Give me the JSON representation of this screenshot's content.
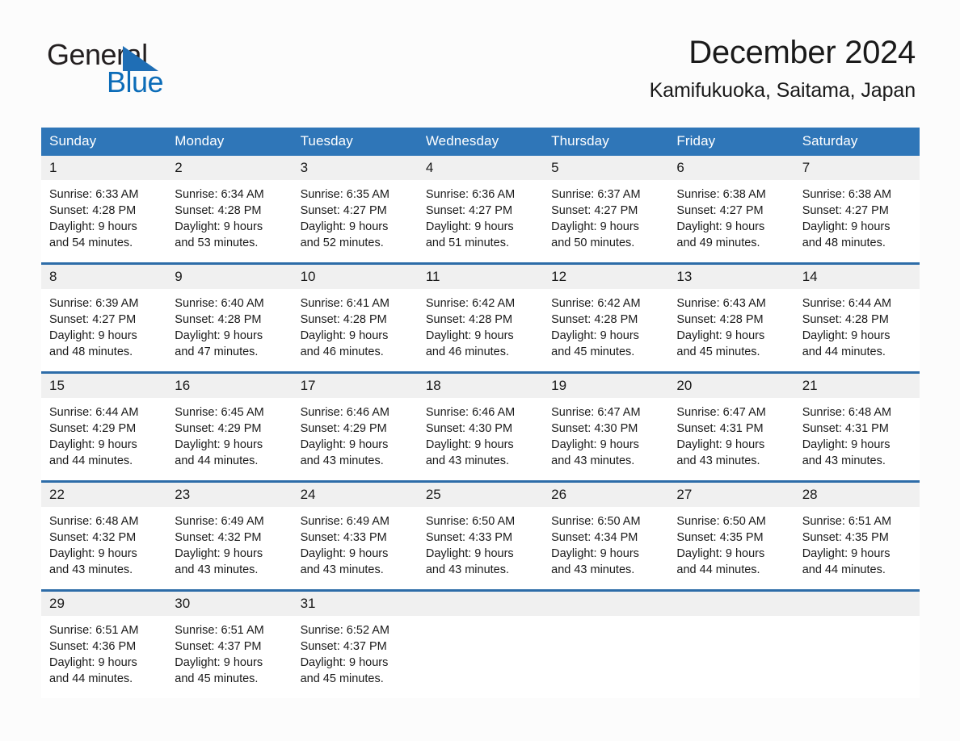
{
  "brand": {
    "name_part1": "General",
    "name_part2": "Blue",
    "triangle_icon": "triangle-icon",
    "accent_color": "#0b6cb8"
  },
  "header": {
    "title": "December 2024",
    "subtitle": "Kamifukuoka, Saitama, Japan"
  },
  "colors": {
    "header_blue": "#2f76b8",
    "divider_blue": "#2d6ca8",
    "daynum_bg": "#f0f0f0",
    "page_bg": "#fcfcfc"
  },
  "weekday_headers": [
    "Sunday",
    "Monday",
    "Tuesday",
    "Wednesday",
    "Thursday",
    "Friday",
    "Saturday"
  ],
  "labels": {
    "sunrise_prefix": "Sunrise:",
    "sunset_prefix": "Sunset:",
    "daylight_prefix": "Daylight:"
  },
  "weeks": [
    [
      {
        "day": "1",
        "sunrise": "Sunrise: 6:33 AM",
        "sunset": "Sunset: 4:28 PM",
        "daylight1": "Daylight: 9 hours",
        "daylight2": "and 54 minutes."
      },
      {
        "day": "2",
        "sunrise": "Sunrise: 6:34 AM",
        "sunset": "Sunset: 4:28 PM",
        "daylight1": "Daylight: 9 hours",
        "daylight2": "and 53 minutes."
      },
      {
        "day": "3",
        "sunrise": "Sunrise: 6:35 AM",
        "sunset": "Sunset: 4:27 PM",
        "daylight1": "Daylight: 9 hours",
        "daylight2": "and 52 minutes."
      },
      {
        "day": "4",
        "sunrise": "Sunrise: 6:36 AM",
        "sunset": "Sunset: 4:27 PM",
        "daylight1": "Daylight: 9 hours",
        "daylight2": "and 51 minutes."
      },
      {
        "day": "5",
        "sunrise": "Sunrise: 6:37 AM",
        "sunset": "Sunset: 4:27 PM",
        "daylight1": "Daylight: 9 hours",
        "daylight2": "and 50 minutes."
      },
      {
        "day": "6",
        "sunrise": "Sunrise: 6:38 AM",
        "sunset": "Sunset: 4:27 PM",
        "daylight1": "Daylight: 9 hours",
        "daylight2": "and 49 minutes."
      },
      {
        "day": "7",
        "sunrise": "Sunrise: 6:38 AM",
        "sunset": "Sunset: 4:27 PM",
        "daylight1": "Daylight: 9 hours",
        "daylight2": "and 48 minutes."
      }
    ],
    [
      {
        "day": "8",
        "sunrise": "Sunrise: 6:39 AM",
        "sunset": "Sunset: 4:27 PM",
        "daylight1": "Daylight: 9 hours",
        "daylight2": "and 48 minutes."
      },
      {
        "day": "9",
        "sunrise": "Sunrise: 6:40 AM",
        "sunset": "Sunset: 4:28 PM",
        "daylight1": "Daylight: 9 hours",
        "daylight2": "and 47 minutes."
      },
      {
        "day": "10",
        "sunrise": "Sunrise: 6:41 AM",
        "sunset": "Sunset: 4:28 PM",
        "daylight1": "Daylight: 9 hours",
        "daylight2": "and 46 minutes."
      },
      {
        "day": "11",
        "sunrise": "Sunrise: 6:42 AM",
        "sunset": "Sunset: 4:28 PM",
        "daylight1": "Daylight: 9 hours",
        "daylight2": "and 46 minutes."
      },
      {
        "day": "12",
        "sunrise": "Sunrise: 6:42 AM",
        "sunset": "Sunset: 4:28 PM",
        "daylight1": "Daylight: 9 hours",
        "daylight2": "and 45 minutes."
      },
      {
        "day": "13",
        "sunrise": "Sunrise: 6:43 AM",
        "sunset": "Sunset: 4:28 PM",
        "daylight1": "Daylight: 9 hours",
        "daylight2": "and 45 minutes."
      },
      {
        "day": "14",
        "sunrise": "Sunrise: 6:44 AM",
        "sunset": "Sunset: 4:28 PM",
        "daylight1": "Daylight: 9 hours",
        "daylight2": "and 44 minutes."
      }
    ],
    [
      {
        "day": "15",
        "sunrise": "Sunrise: 6:44 AM",
        "sunset": "Sunset: 4:29 PM",
        "daylight1": "Daylight: 9 hours",
        "daylight2": "and 44 minutes."
      },
      {
        "day": "16",
        "sunrise": "Sunrise: 6:45 AM",
        "sunset": "Sunset: 4:29 PM",
        "daylight1": "Daylight: 9 hours",
        "daylight2": "and 44 minutes."
      },
      {
        "day": "17",
        "sunrise": "Sunrise: 6:46 AM",
        "sunset": "Sunset: 4:29 PM",
        "daylight1": "Daylight: 9 hours",
        "daylight2": "and 43 minutes."
      },
      {
        "day": "18",
        "sunrise": "Sunrise: 6:46 AM",
        "sunset": "Sunset: 4:30 PM",
        "daylight1": "Daylight: 9 hours",
        "daylight2": "and 43 minutes."
      },
      {
        "day": "19",
        "sunrise": "Sunrise: 6:47 AM",
        "sunset": "Sunset: 4:30 PM",
        "daylight1": "Daylight: 9 hours",
        "daylight2": "and 43 minutes."
      },
      {
        "day": "20",
        "sunrise": "Sunrise: 6:47 AM",
        "sunset": "Sunset: 4:31 PM",
        "daylight1": "Daylight: 9 hours",
        "daylight2": "and 43 minutes."
      },
      {
        "day": "21",
        "sunrise": "Sunrise: 6:48 AM",
        "sunset": "Sunset: 4:31 PM",
        "daylight1": "Daylight: 9 hours",
        "daylight2": "and 43 minutes."
      }
    ],
    [
      {
        "day": "22",
        "sunrise": "Sunrise: 6:48 AM",
        "sunset": "Sunset: 4:32 PM",
        "daylight1": "Daylight: 9 hours",
        "daylight2": "and 43 minutes."
      },
      {
        "day": "23",
        "sunrise": "Sunrise: 6:49 AM",
        "sunset": "Sunset: 4:32 PM",
        "daylight1": "Daylight: 9 hours",
        "daylight2": "and 43 minutes."
      },
      {
        "day": "24",
        "sunrise": "Sunrise: 6:49 AM",
        "sunset": "Sunset: 4:33 PM",
        "daylight1": "Daylight: 9 hours",
        "daylight2": "and 43 minutes."
      },
      {
        "day": "25",
        "sunrise": "Sunrise: 6:50 AM",
        "sunset": "Sunset: 4:33 PM",
        "daylight1": "Daylight: 9 hours",
        "daylight2": "and 43 minutes."
      },
      {
        "day": "26",
        "sunrise": "Sunrise: 6:50 AM",
        "sunset": "Sunset: 4:34 PM",
        "daylight1": "Daylight: 9 hours",
        "daylight2": "and 43 minutes."
      },
      {
        "day": "27",
        "sunrise": "Sunrise: 6:50 AM",
        "sunset": "Sunset: 4:35 PM",
        "daylight1": "Daylight: 9 hours",
        "daylight2": "and 44 minutes."
      },
      {
        "day": "28",
        "sunrise": "Sunrise: 6:51 AM",
        "sunset": "Sunset: 4:35 PM",
        "daylight1": "Daylight: 9 hours",
        "daylight2": "and 44 minutes."
      }
    ],
    [
      {
        "day": "29",
        "sunrise": "Sunrise: 6:51 AM",
        "sunset": "Sunset: 4:36 PM",
        "daylight1": "Daylight: 9 hours",
        "daylight2": "and 44 minutes."
      },
      {
        "day": "30",
        "sunrise": "Sunrise: 6:51 AM",
        "sunset": "Sunset: 4:37 PM",
        "daylight1": "Daylight: 9 hours",
        "daylight2": "and 45 minutes."
      },
      {
        "day": "31",
        "sunrise": "Sunrise: 6:52 AM",
        "sunset": "Sunset: 4:37 PM",
        "daylight1": "Daylight: 9 hours",
        "daylight2": "and 45 minutes."
      },
      {
        "day": "",
        "sunrise": "",
        "sunset": "",
        "daylight1": "",
        "daylight2": ""
      },
      {
        "day": "",
        "sunrise": "",
        "sunset": "",
        "daylight1": "",
        "daylight2": ""
      },
      {
        "day": "",
        "sunrise": "",
        "sunset": "",
        "daylight1": "",
        "daylight2": ""
      },
      {
        "day": "",
        "sunrise": "",
        "sunset": "",
        "daylight1": "",
        "daylight2": ""
      }
    ]
  ]
}
